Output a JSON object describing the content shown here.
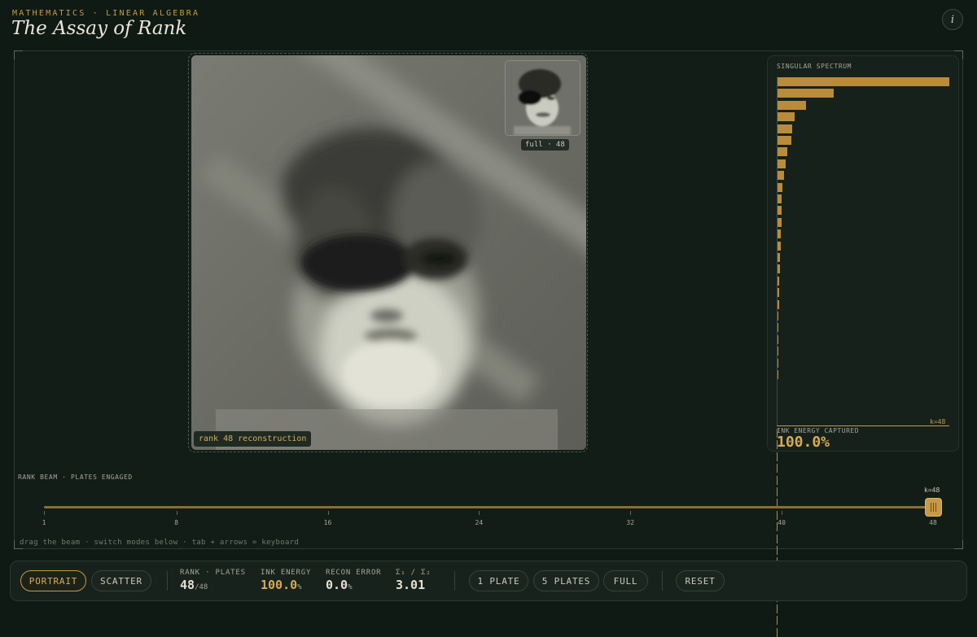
{
  "header": {
    "eyebrow": "MATHEMATICS · LINEAR ALGEBRA",
    "title": "The Assay of Rank",
    "info_label": "i"
  },
  "viewer": {
    "recon_label": "rank 48 reconstruction",
    "thumb_label": "full · 48"
  },
  "spectrum": {
    "title": "SINGULAR SPECTRUM",
    "k_mark": "k=48",
    "energy_caption": "INK ENERGY CAPTURED",
    "energy_value": "100.0%",
    "color": "#b98c3c",
    "singular_values": [
      1.0,
      0.33,
      0.17,
      0.105,
      0.09,
      0.085,
      0.062,
      0.05,
      0.043,
      0.035,
      0.03,
      0.028,
      0.026,
      0.024,
      0.022,
      0.02,
      0.018,
      0.015,
      0.013,
      0.012,
      0.011,
      0.01,
      0.009,
      0.009,
      0.008,
      0.008,
      0.007,
      0.007,
      0.006,
      0.006,
      0.006,
      0.005,
      0.005,
      0.005,
      0.005,
      0.004,
      0.004,
      0.004,
      0.004,
      0.004,
      0.003,
      0.003,
      0.003,
      0.003,
      0.003,
      0.003,
      0.003,
      0.002
    ]
  },
  "rank_beam": {
    "title": "RANK BEAM · PLATES ENGAGED",
    "ticks": [
      "1",
      "8",
      "16",
      "24",
      "32",
      "40",
      "48"
    ],
    "min": 1,
    "max": 48,
    "value": 48,
    "value_label": "k=48",
    "hint": "drag the beam · switch modes below · tab + arrows = keyboard"
  },
  "controls": {
    "mode_portrait": "PORTRAIT",
    "mode_scatter": "SCATTER",
    "rank_label": "RANK · PLATES",
    "rank_value": "48",
    "rank_max": "/48",
    "energy_label": "INK ENERGY",
    "energy_value": "100.0",
    "energy_unit": "%",
    "error_label": "RECON ERROR",
    "error_value": "0.0",
    "error_unit": "%",
    "ratio_label": "Σ₁ / Σ₂",
    "ratio_value": "3.01",
    "btn_one_plate": "1 PLATE",
    "btn_five_plates": "5 PLATES",
    "btn_full": "FULL",
    "btn_reset": "RESET"
  },
  "colors": {
    "accent": "#c79a45",
    "background": "#0f1a15"
  }
}
